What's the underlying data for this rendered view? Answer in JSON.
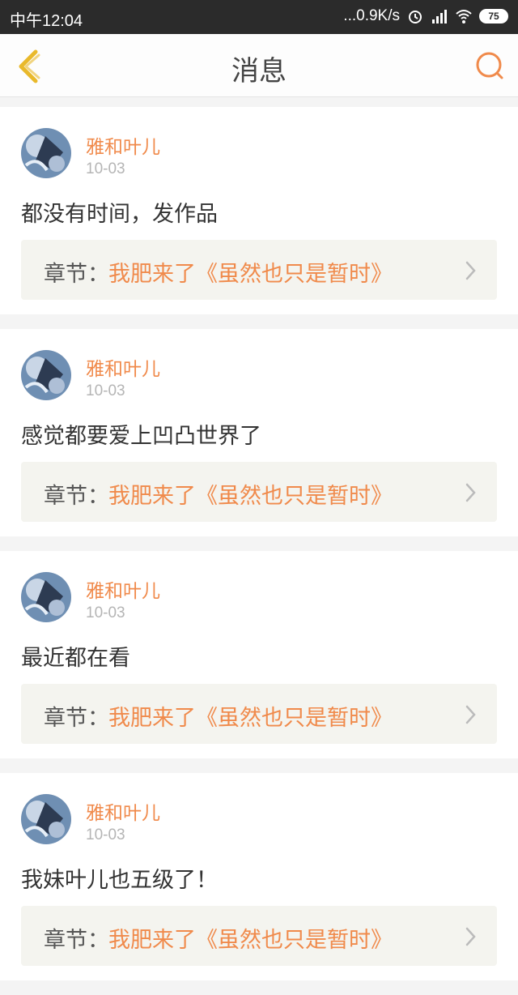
{
  "status_bar": {
    "time": "中午12:04",
    "network_speed": "...0.9K/s",
    "battery": "75"
  },
  "header": {
    "title": "消息",
    "back_icon": "chevron-left-icon",
    "search_icon": "search-icon"
  },
  "colors": {
    "accent": "#f08a4b",
    "back_icon": "#e9b92b"
  },
  "messages": [
    {
      "author": "雅和叶儿",
      "date": "10-03",
      "text": "都没有时间，发作品",
      "chapter_prefix": "章节：",
      "chapter_title": "我肥来了《虽然也只是暂时》"
    },
    {
      "author": "雅和叶儿",
      "date": "10-03",
      "text": "感觉都要爱上凹凸世界了",
      "chapter_prefix": "章节：",
      "chapter_title": "我肥来了《虽然也只是暂时》"
    },
    {
      "author": "雅和叶儿",
      "date": "10-03",
      "text": "最近都在看",
      "chapter_prefix": "章节：",
      "chapter_title": "我肥来了《虽然也只是暂时》"
    },
    {
      "author": "雅和叶儿",
      "date": "10-03",
      "text": "我妹叶儿也五级了！",
      "chapter_prefix": "章节：",
      "chapter_title": "我肥来了《虽然也只是暂时》"
    }
  ]
}
